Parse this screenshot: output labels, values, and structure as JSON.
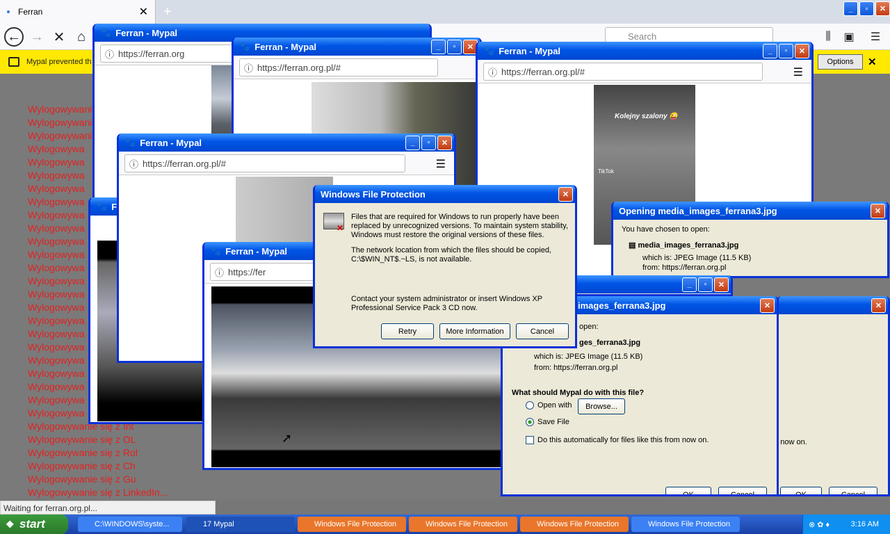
{
  "browser": {
    "tab_title": "Ferran",
    "notice": "Mypal prevented th",
    "options": "Options",
    "search_placeholder": "Search",
    "status": "Waiting for ferran.org.pl..."
  },
  "windows": {
    "title": "Ferran - Mypal",
    "url_short": "https://ferran.org",
    "url_long": "https://ferran.org.pl/#",
    "url_tiny": "https://fer"
  },
  "red_lines": [
    "Wylogowywani",
    "Wylogowywani",
    "Wylogowywani",
    "Wylogowywa",
    "Wylogowywa",
    "Wylogowywa",
    "Wylogowywa",
    "Wylogowywa",
    "Wylogowywa",
    "Wylogowywa",
    "Wylogowywa",
    "Wylogowywa",
    "Wylogowywa",
    "Wylogowywa",
    "Wylogowywa",
    "Wylogowywa",
    "Wylogowywa",
    "Wylogowywa",
    "Wylogowywa",
    "Wylogowywa",
    "Wylogowywa",
    "Wylogowywa",
    "Wylogowywa",
    "Wylogowywa",
    "Wylogowywanie się z Int",
    "Wylogowywanie się z OL",
    "Wylogowywanie się z Rol",
    "Wylogowywanie się z Ch",
    "Wylogowywanie się z Gu",
    "Wylogowywanie się z LinkedIn..."
  ],
  "wfp": {
    "title": "Windows File Protection",
    "p1": "Files that are required for Windows to run properly have been replaced by unrecognized versions.  To maintain system stability, Windows must restore the original versions of these files.",
    "p2": "The network location from which the files should be copied, C:\\$WIN_NT$.~LS, is not available.",
    "p3": "Contact your system administrator or insert Windows XP Professional Service Pack 3 CD now.",
    "retry": "Retry",
    "more": "More Information",
    "cancel": "Cancel"
  },
  "download": {
    "title1": "Opening media_images_ferrana3.jpg",
    "title2": "images_ferrana3.jpg",
    "chosen": "You have chosen to open:",
    "chosen2": "open:",
    "file": "media_images_ferrana3.jpg",
    "file2": "ges_ferrana3.jpg",
    "which": "which is:",
    "type": "JPEG Image (11.5 KB)",
    "from": "from:",
    "from_url": "https://ferran.org.pl",
    "from_partial": "from: https://ferran.org.pl",
    "question": "What should Mypal do with this file?",
    "open_with": "Open with",
    "browse": "Browse...",
    "save": "Save File",
    "auto": "Do this automatically for files like this from now on.",
    "auto_tail": "m now on.",
    "ok": "OK",
    "cancel": "Cancel"
  },
  "video": {
    "caption": "Kolejny szalony 😜",
    "tiktok": "TikTok"
  },
  "taskbar": {
    "start": "start",
    "cmd": "C:\\WINDOWS\\syste...",
    "mypal": "17 Mypal",
    "wfp": "Windows File Protection",
    "clock": "3:16 AM"
  }
}
